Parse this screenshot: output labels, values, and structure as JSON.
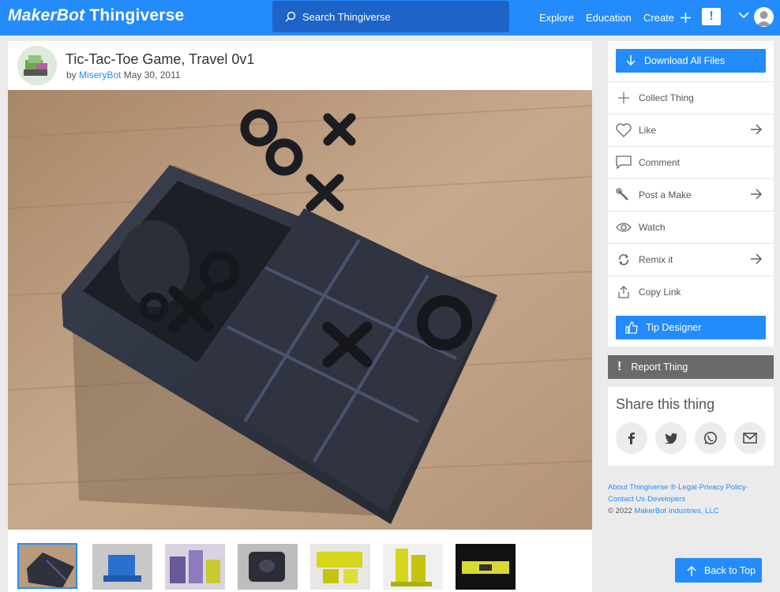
{
  "header": {
    "brand": "MakerBot",
    "product": "Thingiverse",
    "search_placeholder": "Search Thingiverse",
    "nav": {
      "explore": "Explore",
      "education": "Education",
      "create": "Create"
    },
    "alert_glyph": "!"
  },
  "thing": {
    "title": "Tic-Tac-Toe Game, Travel 0v1",
    "by_prefix": "by",
    "author": "MiseryBot",
    "date": "May 30, 2011"
  },
  "actions": {
    "download": "Download All Files",
    "collect": "Collect Thing",
    "like": "Like",
    "comment": "Comment",
    "post_make": "Post a Make",
    "watch": "Watch",
    "remix": "Remix it",
    "copy_link": "Copy Link",
    "tip": "Tip Designer",
    "report": "Report Thing",
    "report_glyph": "!"
  },
  "share": {
    "title": "Share this thing",
    "icons": [
      "facebook-icon",
      "twitter-icon",
      "whatsapp-icon",
      "email-icon"
    ]
  },
  "footer": {
    "about": "About Thingiverse ®",
    "legal": "Legal",
    "privacy": "Privacy Policy",
    "contact": "Contact Us",
    "developers": "Developers",
    "copyright_prefix": "© 2022",
    "company": "MakerBot Industries, LLC",
    "sep": "·"
  },
  "back_to_top": "Back to Top",
  "colors": {
    "primary": "#248bfb",
    "search_bg": "#1e64c8",
    "report_bg": "#6a6a6a",
    "page_bg": "#ebebeb"
  }
}
